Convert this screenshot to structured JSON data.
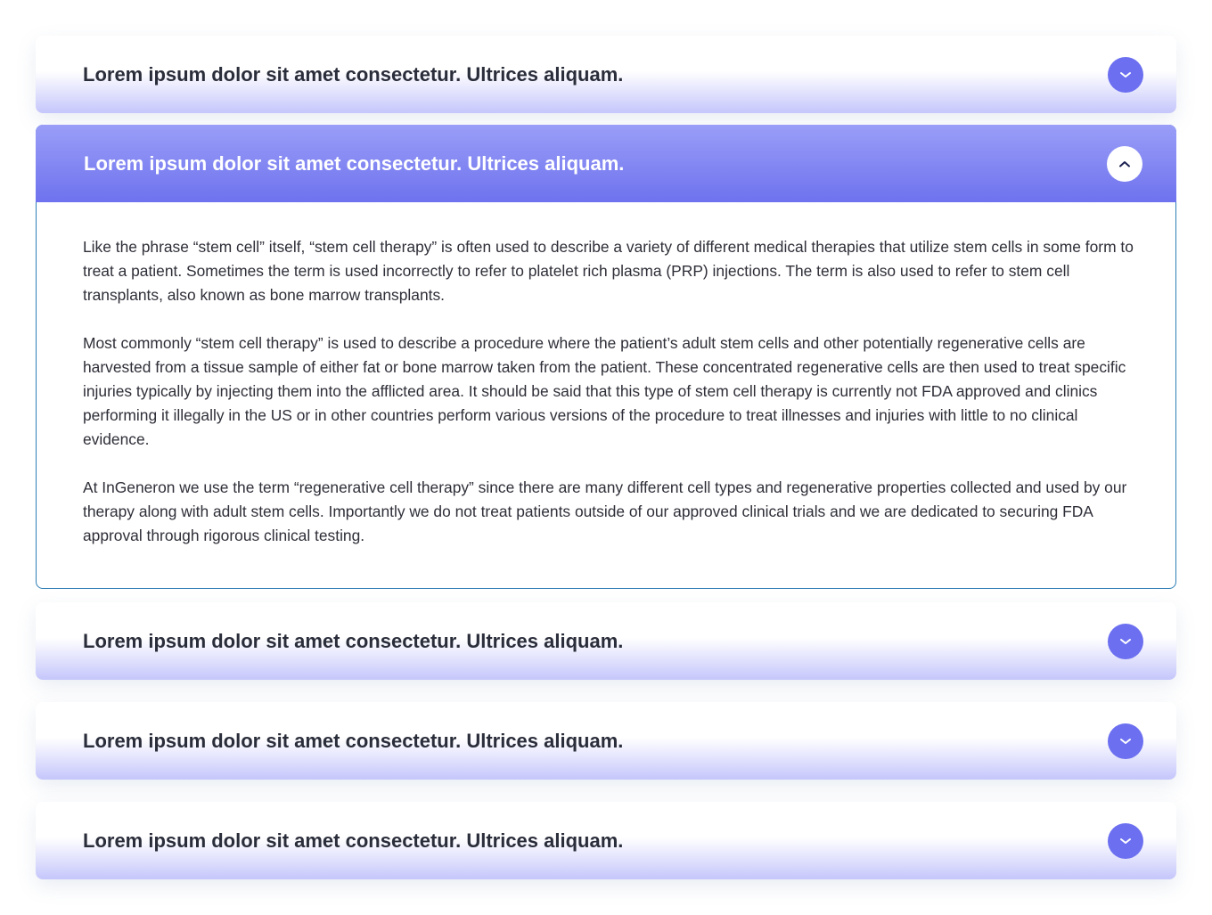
{
  "faq": {
    "items": [
      {
        "question": "Lorem ipsum dolor sit amet consectetur. Ultrices aliquam.",
        "state": "collapsed",
        "toggle_icon": "chevron-down-icon"
      },
      {
        "question": "Lorem ipsum dolor sit amet consectetur. Ultrices aliquam.",
        "state": "expanded",
        "toggle_icon": "chevron-up-icon",
        "answer": [
          "Like the phrase “stem cell” itself, “stem cell therapy” is often used to describe a variety of different medical therapies that utilize stem cells in some form to treat a patient. Sometimes the term is used incorrectly to refer to platelet rich plasma (PRP) injections. The term is also used to refer to stem cell transplants, also known as bone marrow transplants.",
          "Most commonly “stem cell therapy” is used to describe a procedure where the patient’s adult stem cells and other potentially regenerative cells are harvested from a tissue sample of either fat or bone marrow taken from the patient. These concentrated regenerative cells are then used to treat specific injuries typically by injecting them into the afflicted area. It should be said that this type of stem cell therapy is currently not FDA approved and clinics performing it illegally in the US or in other countries perform various versions of the procedure to treat illnesses and injuries with little to no clinical evidence.",
          "At InGeneron we use the term “regenerative cell therapy” since there are many different cell types and regenerative properties collected and used by our therapy along with adult stem cells. Importantly we do not treat patients outside of our approved clinical trials and we are dedicated to securing FDA approval through rigorous clinical testing."
        ]
      },
      {
        "question": "Lorem ipsum dolor sit amet consectetur. Ultrices aliquam.",
        "state": "collapsed",
        "toggle_icon": "chevron-down-icon"
      },
      {
        "question": "Lorem ipsum dolor sit amet consectetur. Ultrices aliquam.",
        "state": "collapsed",
        "toggle_icon": "chevron-down-icon"
      },
      {
        "question": "Lorem ipsum dolor sit amet consectetur. Ultrices aliquam.",
        "state": "collapsed",
        "toggle_icon": "chevron-down-icon"
      }
    ]
  },
  "colors": {
    "accent": "#6b6ff0",
    "accent_light": "#9a9ef7",
    "collapsed_gradient_end": "#c5c6fb",
    "expanded_border": "#2f7fb5",
    "title_text": "#2a2d3a",
    "body_text": "#2e2f38"
  }
}
